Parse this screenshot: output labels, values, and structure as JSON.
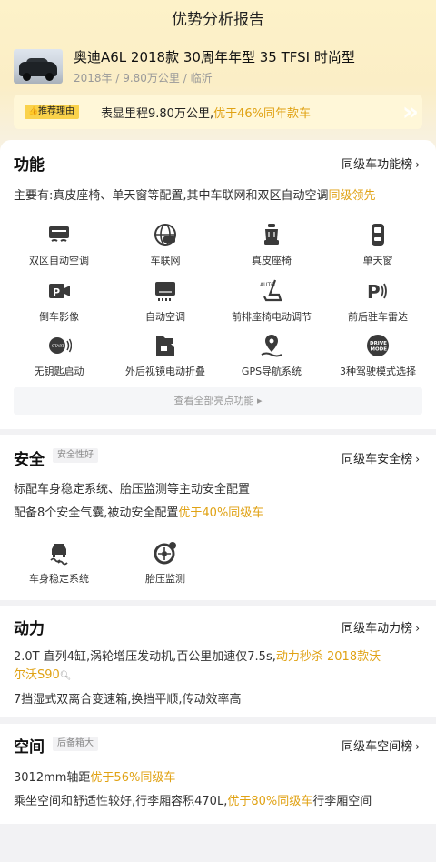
{
  "header": {
    "title": "优势分析报告"
  },
  "car": {
    "name": "奥迪A6L 2018款 30周年年型 35 TFSI 时尚型",
    "meta": "2018年 / 9.80万公里 / 临沂"
  },
  "reason": {
    "badge": "推荐理由",
    "text_a": "表显里程9.80万公里,",
    "text_hl": "优于46%同年款车"
  },
  "function": {
    "title": "功能",
    "link": "同级车功能榜",
    "desc_a": "主要有:真皮座椅、单天窗等配置,其中车联网和双区自动空调",
    "desc_hl": "同级领先",
    "items": [
      {
        "label": "双区自动空调",
        "icon": "dual-zone-ac-icon"
      },
      {
        "label": "车联网",
        "icon": "connected-car-icon"
      },
      {
        "label": "真皮座椅",
        "icon": "leather-seat-icon"
      },
      {
        "label": "单天窗",
        "icon": "sunroof-icon"
      },
      {
        "label": "倒车影像",
        "icon": "reverse-camera-icon"
      },
      {
        "label": "自动空调",
        "icon": "auto-ac-icon"
      },
      {
        "label": "前排座椅电动调节",
        "icon": "power-seat-icon"
      },
      {
        "label": "前后驻车雷达",
        "icon": "parking-radar-icon"
      },
      {
        "label": "无钥匙启动",
        "icon": "keyless-start-icon"
      },
      {
        "label": "外后视镜电动折叠",
        "icon": "mirror-fold-icon"
      },
      {
        "label": "GPS导航系统",
        "icon": "gps-icon"
      },
      {
        "label": "3种驾驶模式选择",
        "icon": "drive-mode-icon"
      }
    ],
    "more": "查看全部亮点功能"
  },
  "safety": {
    "title": "安全",
    "tag": "安全性好",
    "link": "同级车安全榜",
    "line1": "标配车身稳定系统、胎压监测等主动安全配置",
    "line2_a": "配备8个安全气囊,被动安全配置",
    "line2_hl": "优于40%同级车",
    "items": [
      {
        "label": "车身稳定系统",
        "icon": "stability-control-icon"
      },
      {
        "label": "胎压监测",
        "icon": "tire-pressure-icon"
      }
    ]
  },
  "power": {
    "title": "动力",
    "link": "同级车动力榜",
    "line1_a": "2.0T 直列4缸,涡轮增压发动机,百公里加速仅7.5s,",
    "line1_hl": "动力秒杀 2018款沃",
    "line1b_hl": "尔沃S90",
    "line2": "7挡湿式双离合变速箱,换挡平顺,传动效率高"
  },
  "space": {
    "title": "空间",
    "tag": "后备箱大",
    "link": "同级车空间榜",
    "line1_a": "3012mm轴距",
    "line1_hl": "优于56%同级车",
    "line2_a": "乘坐空间和舒适性较好,行李厢容积470L,",
    "line2_hl": "优于80%同级车",
    "line2_b": "行李厢空间"
  },
  "colors": {
    "accent": "#e0a214",
    "badge": "#fad24b"
  }
}
